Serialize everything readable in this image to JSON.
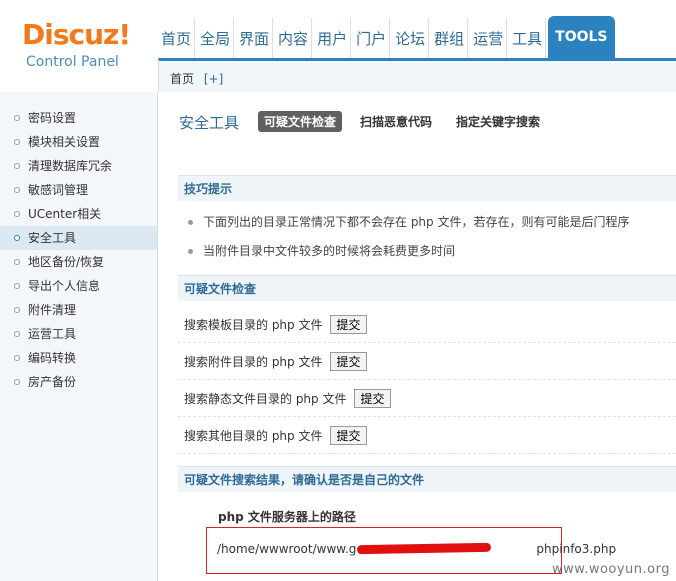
{
  "logo": {
    "name": "Discuz!",
    "subtitle": "Control Panel"
  },
  "topnav": [
    "首页",
    "全局",
    "界面",
    "内容",
    "用户",
    "门户",
    "论坛",
    "群组",
    "运营",
    "工具"
  ],
  "topnav_tools": "TOOLS",
  "breadcrumb": {
    "home": "首页",
    "plus": "[+]"
  },
  "sidebar": {
    "items": [
      {
        "label": "密码设置"
      },
      {
        "label": "模块相关设置"
      },
      {
        "label": "清理数据库冗余"
      },
      {
        "label": "敏感词管理"
      },
      {
        "label": "UCenter相关"
      },
      {
        "label": "安全工具",
        "active": true
      },
      {
        "label": "地区备份/恢复"
      },
      {
        "label": "导出个人信息"
      },
      {
        "label": "附件清理"
      },
      {
        "label": "运营工具"
      },
      {
        "label": "编码转换"
      },
      {
        "label": "房产备份"
      }
    ]
  },
  "main": {
    "title": "安全工具",
    "tabs": [
      {
        "label": "可疑文件检查",
        "current": true
      },
      {
        "label": "扫描恶意代码"
      },
      {
        "label": "指定关键字搜索"
      }
    ],
    "tips_header": "技巧提示",
    "tips": [
      "下面列出的目录正常情况下都不会存在 php 文件，若存在，则有可能是后门程序",
      "当附件目录中文件较多的时候将会耗费更多时间"
    ],
    "scan_header": "可疑文件检查",
    "scan_rows": [
      {
        "label": "搜索模板目录的 php 文件",
        "button": "提交"
      },
      {
        "label": "搜索附件目录的 php 文件",
        "button": "提交"
      },
      {
        "label": "搜索静态文件目录的 php 文件",
        "button": "提交"
      },
      {
        "label": "搜索其他目录的 php 文件",
        "button": "提交"
      }
    ],
    "result_header": "可疑文件搜索结果，请确认是否是自己的文件",
    "result_column": "php 文件服务器上的路径",
    "result_path": "/home/wwwroot/www.g               phpinfo3.php"
  },
  "watermark": "www.wooyun.org",
  "colors": {
    "accent": "#2b82bf",
    "logo": "#f27a1b",
    "link": "#2d6b97",
    "redaction": "#e01010"
  }
}
